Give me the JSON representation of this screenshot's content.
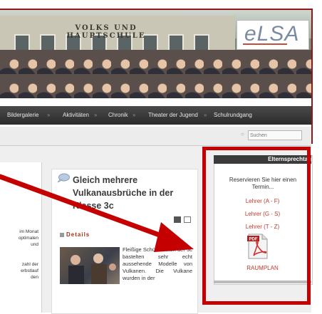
{
  "banner": {
    "school_sign": "VOLKS UND HAUPTSCHULE",
    "logo": "eLSA"
  },
  "nav": {
    "items": [
      "Bildergalerie",
      "Aktivitäten",
      "Chronik",
      "Theater der Jugend",
      "Schulrundgang"
    ],
    "separator": "»"
  },
  "search": {
    "placeholder": "Suchen"
  },
  "left_column": {
    "lines_top": [
      "im Monat",
      "optimalen",
      "und"
    ],
    "lines_bottom": [
      "zahl der",
      "erbstlauf",
      "den"
    ]
  },
  "article": {
    "title": "Gleich mehrere Vulkanausbrüche in der Klasse 3c",
    "details_label": "Details",
    "text": "Fleißige Schüler/innen der 3c bastelten sehr echt aussehende Modelle von Vulkanen. Die Vulkane wurden in der"
  },
  "sidebar": {
    "header": "Elternsprechtag",
    "intro": "Reservieren Sie hier einen Termin...",
    "links": [
      "Lehrer (A - F)",
      "Lehrer (G - S)",
      "Lehrer (T - Z)"
    ],
    "pdf_badge": "PDF",
    "raumplan": "RAUMPLAN"
  },
  "colors": {
    "accent_red": "#c40000",
    "link_red": "#c0392b",
    "nav_bg": "#2b2b2b",
    "frame": "#8b1a1a"
  }
}
